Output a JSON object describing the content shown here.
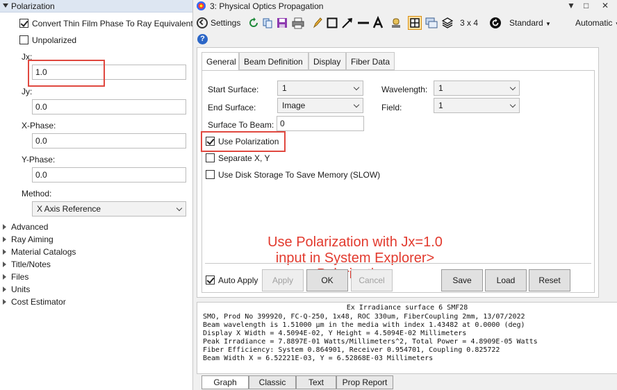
{
  "explorer": {
    "section_title": "Polarization",
    "convert_thin_film_label": "Convert Thin Film Phase To Ray Equivalent",
    "unpolarized_label": "Unpolarized",
    "jx_label": "Jx:",
    "jx_value": "1.0",
    "jy_label": "Jy:",
    "jy_value": "0.0",
    "xphase_label": "X-Phase:",
    "xphase_value": "0.0",
    "yphase_label": "Y-Phase:",
    "yphase_value": "0.0",
    "method_label": "Method:",
    "method_value": "X Axis Reference",
    "tree": [
      "Advanced",
      "Ray Aiming",
      "Material Catalogs",
      "Title/Notes",
      "Files",
      "Units",
      "Cost Estimator"
    ]
  },
  "window": {
    "title": "3: Physical Optics Propagation",
    "controls": [
      "▼",
      "□",
      "✕"
    ],
    "settings_label": "Settings",
    "layout_label": "3 x 4",
    "standard_label": "Standard",
    "automatic_label": "Automatic"
  },
  "tabs": [
    "General",
    "Beam Definition",
    "Display",
    "Fiber Data"
  ],
  "general": {
    "start_surface_label": "Start Surface:",
    "start_surface_value": "1",
    "end_surface_label": "End Surface:",
    "end_surface_value": "Image",
    "surface_to_beam_label": "Surface To Beam:",
    "surface_to_beam_value": "0",
    "wavelength_label": "Wavelength:",
    "wavelength_value": "1",
    "field_label": "Field:",
    "field_value": "1",
    "use_polarization_label": "Use Polarization",
    "separate_xy_label": "Separate X, Y",
    "disk_storage_label": "Use Disk Storage To Save Memory (SLOW)",
    "auto_apply_label": "Auto Apply",
    "apply_label": "Apply",
    "ok_label": "OK",
    "cancel_label": "Cancel",
    "save_label": "Save",
    "load_label": "Load",
    "reset_label": "Reset"
  },
  "annotation": {
    "line1": "Use Polarization with Jx=1.0",
    "line2": "input in System Explorer>",
    "line3": "Polarization."
  },
  "output": {
    "header": "Ex Irradiance surface 6 SMF28",
    "lines": [
      "SMO, Prod No 399920, FC-Q-250, 1x48, ROC 330um, FiberCoupling 2mm, 13/07/2022",
      "Beam wavelength is 1.51000 µm in the media with index 1.43482 at 0.0000 (deg)",
      "Display X Width = 4.5094E-02, Y Height = 4.5094E-02 Millimeters",
      "Peak Irradiance = 7.8897E-01 Watts/Millimeters^2, Total Power = 4.8909E-05 Watts",
      "Fiber Efficiency: System 0.864901, Receiver 0.954701, Coupling 0.825722",
      "Beam Width X = 6.52221E-03, Y = 6.52868E-03 Millimeters"
    ]
  },
  "bottom_tabs": [
    "Graph",
    "Classic",
    "Text",
    "Prop Report"
  ],
  "colors": {
    "annotation": "#e23a2e",
    "highlight_box": "#e0483f",
    "header_bg": "#dde6f2"
  }
}
